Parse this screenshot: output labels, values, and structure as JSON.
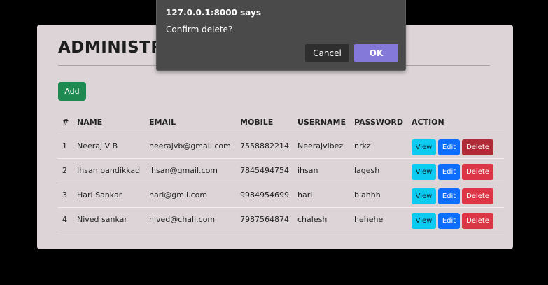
{
  "page": {
    "title": "ADMINISTRATOR",
    "add_label": "Add"
  },
  "table": {
    "headers": [
      "#",
      "NAME",
      "EMAIL",
      "MOBILE",
      "USERNAME",
      "PASSWORD",
      "ACTION"
    ],
    "rows": [
      {
        "num": "1",
        "name": "Neeraj V B",
        "email": "neerajvb@gmail.com",
        "mobile": "7558882214",
        "username": "Neerajvibez",
        "password": "nrkz"
      },
      {
        "num": "2",
        "name": "Ihsan pandikkad",
        "email": "ihsan@gmail.com",
        "mobile": "7845494754",
        "username": "ihsan",
        "password": "lagesh"
      },
      {
        "num": "3",
        "name": "Hari Sankar",
        "email": "hari@gmil.com",
        "mobile": "9984954699",
        "username": "hari",
        "password": "blahhh"
      },
      {
        "num": "4",
        "name": "Nived sankar",
        "email": "nived@chali.com",
        "mobile": "7987564874",
        "username": "chalesh",
        "password": "hehehe"
      }
    ],
    "actions": {
      "view": "View",
      "edit": "Edit",
      "delete": "Delete"
    }
  },
  "dialog": {
    "origin": "127.0.0.1:8000 says",
    "message": "Confirm delete?",
    "cancel_label": "Cancel",
    "ok_label": "OK"
  },
  "colors": {
    "card_bg": "#dcd4d6",
    "add_button": "#1e8a52",
    "view_button": "#0dcaf0",
    "edit_button": "#0d6efd",
    "delete_button": "#dc3545",
    "dialog_bg": "#4a4a4a",
    "dialog_ok": "#8478d8"
  }
}
